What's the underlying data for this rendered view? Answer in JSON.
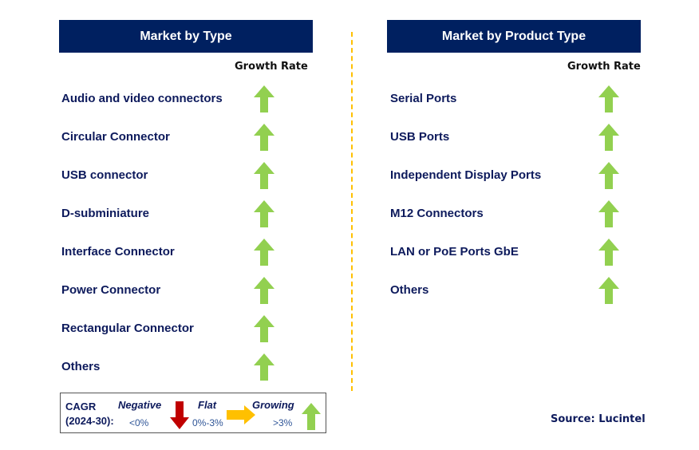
{
  "left_panel": {
    "title": "Market by Type",
    "growth_label": "Growth Rate",
    "items": [
      {
        "label": "Audio and video connectors",
        "trend": "growing"
      },
      {
        "label": "Circular Connector",
        "trend": "growing"
      },
      {
        "label": "USB connector",
        "trend": "growing"
      },
      {
        "label": "D-subminiature",
        "trend": "growing"
      },
      {
        "label": "Interface Connector",
        "trend": "growing"
      },
      {
        "label": "Power Connector",
        "trend": "growing"
      },
      {
        "label": "Rectangular Connector",
        "trend": "growing"
      },
      {
        "label": "Others",
        "trend": "growing"
      }
    ]
  },
  "right_panel": {
    "title": "Market by Product Type",
    "growth_label": "Growth Rate",
    "items": [
      {
        "label": "Serial Ports",
        "trend": "growing"
      },
      {
        "label": "USB Ports",
        "trend": "growing"
      },
      {
        "label": "Independent Display Ports",
        "trend": "growing"
      },
      {
        "label": "M12 Connectors",
        "trend": "growing"
      },
      {
        "label": "LAN or PoE Ports GbE",
        "trend": "growing"
      },
      {
        "label": "Others",
        "trend": "growing"
      }
    ]
  },
  "legend": {
    "cagr_label": "CAGR",
    "period_label": "(2024-30):",
    "negative": {
      "label": "Negative",
      "range": "<0%",
      "color": "#c00000"
    },
    "flat": {
      "label": "Flat",
      "range": "0%-3%",
      "color": "#ffc000"
    },
    "growing": {
      "label": "Growing",
      "range": ">3%",
      "color": "#92d050"
    }
  },
  "colors": {
    "header_bg": "#002060",
    "text": "#0d1a5c",
    "divider": "#ffc000"
  },
  "source": "Source: Lucintel"
}
